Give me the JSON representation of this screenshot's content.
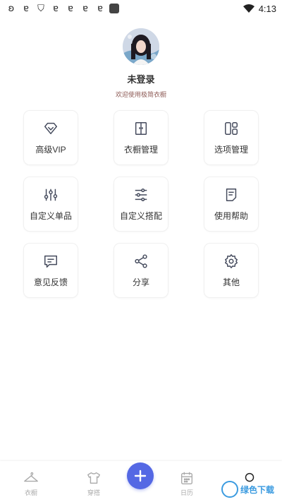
{
  "status_bar": {
    "time": "4:13",
    "notification_icons": [
      "app-icon",
      "app-icon",
      "shield-icon",
      "app-icon",
      "app-icon",
      "app-icon",
      "app-icon",
      "square-icon"
    ]
  },
  "profile": {
    "username": "未登录",
    "welcome": "欢迎使用极简衣橱"
  },
  "menu": [
    {
      "label": "高级VIP",
      "icon": "diamond-icon"
    },
    {
      "label": "衣橱管理",
      "icon": "wardrobe-icon"
    },
    {
      "label": "选项管理",
      "icon": "layout-icon"
    },
    {
      "label": "自定义单品",
      "icon": "sliders-icon"
    },
    {
      "label": "自定义搭配",
      "icon": "filter-lines-icon"
    },
    {
      "label": "使用帮助",
      "icon": "document-icon"
    },
    {
      "label": "意见反馈",
      "icon": "message-icon"
    },
    {
      "label": "分享",
      "icon": "share-icon"
    },
    {
      "label": "其他",
      "icon": "gear-icon"
    }
  ],
  "tabbar": {
    "tabs": [
      {
        "label": "衣橱",
        "icon": "hanger-icon"
      },
      {
        "label": "穿搭",
        "icon": "shirt-icon"
      },
      {
        "label": "日历",
        "icon": "calendar-icon"
      },
      {
        "label": "",
        "icon": "profile-icon"
      }
    ],
    "add_icon": "plus-icon"
  },
  "watermark": {
    "text": "绿色下载"
  },
  "colors": {
    "accent": "#5468e4",
    "icon": "#444a5c",
    "welcome_text": "#8d5a55",
    "tab_inactive": "#aaaaaa"
  }
}
